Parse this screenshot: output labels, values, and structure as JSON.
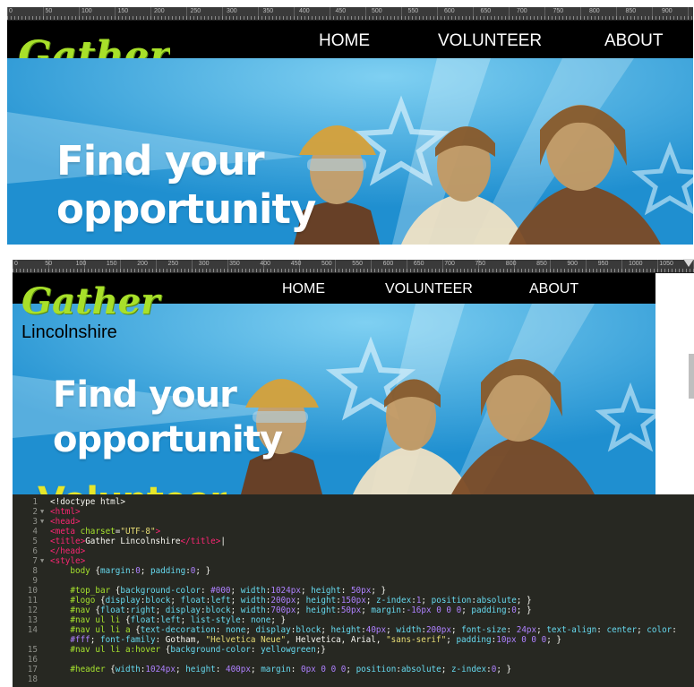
{
  "rulers": {
    "top_labels": [
      "0",
      "50",
      "100",
      "150",
      "200",
      "250",
      "300",
      "350",
      "400",
      "450",
      "500",
      "550",
      "600",
      "650",
      "700",
      "750",
      "800",
      "850",
      "900"
    ],
    "bottom_labels": [
      "0",
      "50",
      "100",
      "150",
      "200",
      "250",
      "300",
      "350",
      "400",
      "450",
      "500",
      "550",
      "600",
      "650",
      "700",
      "750",
      "800",
      "850",
      "900",
      "950",
      "1000",
      "1050"
    ]
  },
  "site": {
    "logo_title": "Gather",
    "logo_subtitle": "Lincolnshire",
    "nav": [
      "HOME",
      "VOLUNTEER",
      "ABOUT"
    ],
    "banner_line1": "Find your",
    "banner_line2": "opportunity",
    "banner_line3": "Volunteer"
  },
  "colors": {
    "top_bar": "#000000",
    "banner_blue": "#2aa0dc",
    "logo_green": "#a8e02a",
    "editor_bg": "#272822"
  },
  "editor": {
    "lines": [
      {
        "n": "1",
        "fold": "",
        "parts": [
          [
            "t-plain",
            "<!doctype html>"
          ]
        ]
      },
      {
        "n": "2",
        "fold": "▼",
        "parts": [
          [
            "t-tag",
            "<html>"
          ]
        ]
      },
      {
        "n": "3",
        "fold": "▼",
        "parts": [
          [
            "t-tag",
            "<head>"
          ]
        ]
      },
      {
        "n": "4",
        "fold": "",
        "parts": [
          [
            "t-tag",
            "<meta "
          ],
          [
            "t-attr",
            "charset"
          ],
          [
            "t-plain",
            "="
          ],
          [
            "t-str",
            "\"UTF-8\""
          ],
          [
            "t-tag",
            ">"
          ]
        ]
      },
      {
        "n": "5",
        "fold": "",
        "parts": [
          [
            "t-tag",
            "<title>"
          ],
          [
            "t-plain",
            "Gather Lincolnshire"
          ],
          [
            "t-tag",
            "</title>"
          ],
          [
            "t-plain",
            "|"
          ]
        ]
      },
      {
        "n": "6",
        "fold": "",
        "parts": [
          [
            "t-tag",
            "</head>"
          ]
        ]
      },
      {
        "n": "7",
        "fold": "▼",
        "parts": [
          [
            "t-tag",
            "<style>"
          ]
        ]
      },
      {
        "n": "8",
        "fold": "",
        "parts": [
          [
            "t-plain",
            "    "
          ],
          [
            "t-sel",
            "body"
          ],
          [
            "t-plain",
            " {"
          ],
          [
            "t-prop",
            "margin"
          ],
          [
            "t-plain",
            ":"
          ],
          [
            "t-num",
            "0"
          ],
          [
            "t-plain",
            "; "
          ],
          [
            "t-prop",
            "padding"
          ],
          [
            "t-plain",
            ":"
          ],
          [
            "t-num",
            "0"
          ],
          [
            "t-plain",
            "; }"
          ]
        ]
      },
      {
        "n": "9",
        "fold": "",
        "parts": [
          [
            "t-plain",
            ""
          ]
        ]
      },
      {
        "n": "10",
        "fold": "",
        "parts": [
          [
            "t-plain",
            "    "
          ],
          [
            "t-sel",
            "#top_bar"
          ],
          [
            "t-plain",
            " {"
          ],
          [
            "t-prop",
            "background-color"
          ],
          [
            "t-plain",
            ": "
          ],
          [
            "t-num",
            "#000"
          ],
          [
            "t-plain",
            "; "
          ],
          [
            "t-prop",
            "width"
          ],
          [
            "t-plain",
            ":"
          ],
          [
            "t-num",
            "1024px"
          ],
          [
            "t-plain",
            "; "
          ],
          [
            "t-prop",
            "height"
          ],
          [
            "t-plain",
            ": "
          ],
          [
            "t-num",
            "50px"
          ],
          [
            "t-plain",
            "; }"
          ]
        ]
      },
      {
        "n": "11",
        "fold": "",
        "parts": [
          [
            "t-plain",
            "    "
          ],
          [
            "t-sel",
            "#logo"
          ],
          [
            "t-plain",
            " {"
          ],
          [
            "t-prop",
            "display"
          ],
          [
            "t-plain",
            ":"
          ],
          [
            "t-prop",
            "block"
          ],
          [
            "t-plain",
            "; "
          ],
          [
            "t-prop",
            "float"
          ],
          [
            "t-plain",
            ":"
          ],
          [
            "t-prop",
            "left"
          ],
          [
            "t-plain",
            "; "
          ],
          [
            "t-prop",
            "width"
          ],
          [
            "t-plain",
            ":"
          ],
          [
            "t-num",
            "200px"
          ],
          [
            "t-plain",
            "; "
          ],
          [
            "t-prop",
            "height"
          ],
          [
            "t-plain",
            ":"
          ],
          [
            "t-num",
            "150px"
          ],
          [
            "t-plain",
            "; "
          ],
          [
            "t-prop",
            "z-index"
          ],
          [
            "t-plain",
            ":"
          ],
          [
            "t-num",
            "1"
          ],
          [
            "t-plain",
            "; "
          ],
          [
            "t-prop",
            "position"
          ],
          [
            "t-plain",
            ":"
          ],
          [
            "t-prop",
            "absolute"
          ],
          [
            "t-plain",
            "; }"
          ]
        ]
      },
      {
        "n": "12",
        "fold": "",
        "parts": [
          [
            "t-plain",
            "    "
          ],
          [
            "t-sel",
            "#nav"
          ],
          [
            "t-plain",
            " {"
          ],
          [
            "t-prop",
            "float"
          ],
          [
            "t-plain",
            ":"
          ],
          [
            "t-prop",
            "right"
          ],
          [
            "t-plain",
            "; "
          ],
          [
            "t-prop",
            "display"
          ],
          [
            "t-plain",
            ":"
          ],
          [
            "t-prop",
            "block"
          ],
          [
            "t-plain",
            "; "
          ],
          [
            "t-prop",
            "width"
          ],
          [
            "t-plain",
            ":"
          ],
          [
            "t-num",
            "700px"
          ],
          [
            "t-plain",
            "; "
          ],
          [
            "t-prop",
            "height"
          ],
          [
            "t-plain",
            ":"
          ],
          [
            "t-num",
            "50px"
          ],
          [
            "t-plain",
            "; "
          ],
          [
            "t-prop",
            "margin"
          ],
          [
            "t-plain",
            ":"
          ],
          [
            "t-num",
            "-16px 0 0 0"
          ],
          [
            "t-plain",
            "; "
          ],
          [
            "t-prop",
            "padding"
          ],
          [
            "t-plain",
            ":"
          ],
          [
            "t-num",
            "0"
          ],
          [
            "t-plain",
            "; }"
          ]
        ]
      },
      {
        "n": "13",
        "fold": "",
        "parts": [
          [
            "t-plain",
            "    "
          ],
          [
            "t-sel",
            "#nav ul li"
          ],
          [
            "t-plain",
            " {"
          ],
          [
            "t-prop",
            "float"
          ],
          [
            "t-plain",
            ":"
          ],
          [
            "t-prop",
            "left"
          ],
          [
            "t-plain",
            "; "
          ],
          [
            "t-prop",
            "list-style"
          ],
          [
            "t-plain",
            ": "
          ],
          [
            "t-prop",
            "none"
          ],
          [
            "t-plain",
            "; }"
          ]
        ]
      },
      {
        "n": "14",
        "fold": "",
        "parts": [
          [
            "t-plain",
            "    "
          ],
          [
            "t-sel",
            "#nav ul li a"
          ],
          [
            "t-plain",
            " {"
          ],
          [
            "t-prop",
            "text-decoration"
          ],
          [
            "t-plain",
            ": "
          ],
          [
            "t-prop",
            "none"
          ],
          [
            "t-plain",
            "; "
          ],
          [
            "t-prop",
            "display"
          ],
          [
            "t-plain",
            ":"
          ],
          [
            "t-prop",
            "block"
          ],
          [
            "t-plain",
            "; "
          ],
          [
            "t-prop",
            "height"
          ],
          [
            "t-plain",
            ":"
          ],
          [
            "t-num",
            "40px"
          ],
          [
            "t-plain",
            "; "
          ],
          [
            "t-prop",
            "width"
          ],
          [
            "t-plain",
            ":"
          ],
          [
            "t-num",
            "200px"
          ],
          [
            "t-plain",
            "; "
          ],
          [
            "t-prop",
            "font-size"
          ],
          [
            "t-plain",
            ": "
          ],
          [
            "t-num",
            "24px"
          ],
          [
            "t-plain",
            "; "
          ],
          [
            "t-prop",
            "text-align"
          ],
          [
            "t-plain",
            ": "
          ],
          [
            "t-prop",
            "center"
          ],
          [
            "t-plain",
            "; "
          ],
          [
            "t-prop",
            "color"
          ],
          [
            "t-plain",
            ":"
          ]
        ]
      },
      {
        "n": "",
        "fold": "",
        "parts": [
          [
            "t-plain",
            "    "
          ],
          [
            "t-num",
            "#fff"
          ],
          [
            "t-plain",
            "; "
          ],
          [
            "t-prop",
            "font-family"
          ],
          [
            "t-plain",
            ": Gotham, "
          ],
          [
            "t-str",
            "\"Helvetica Neue\""
          ],
          [
            "t-plain",
            ", Helvetica, Arial, "
          ],
          [
            "t-str",
            "\"sans-serif\""
          ],
          [
            "t-plain",
            "; "
          ],
          [
            "t-prop",
            "padding"
          ],
          [
            "t-plain",
            ":"
          ],
          [
            "t-num",
            "10px 0 0 0"
          ],
          [
            "t-plain",
            "; }"
          ]
        ]
      },
      {
        "n": "15",
        "fold": "",
        "parts": [
          [
            "t-plain",
            "    "
          ],
          [
            "t-sel",
            "#nav ul li a:hover"
          ],
          [
            "t-plain",
            " {"
          ],
          [
            "t-prop",
            "background-color"
          ],
          [
            "t-plain",
            ": "
          ],
          [
            "t-prop",
            "yellowgreen"
          ],
          [
            "t-plain",
            ";}"
          ]
        ]
      },
      {
        "n": "16",
        "fold": "",
        "parts": [
          [
            "t-plain",
            ""
          ]
        ]
      },
      {
        "n": "17",
        "fold": "",
        "parts": [
          [
            "t-plain",
            "    "
          ],
          [
            "t-sel",
            "#header"
          ],
          [
            "t-plain",
            " {"
          ],
          [
            "t-prop",
            "width"
          ],
          [
            "t-plain",
            ":"
          ],
          [
            "t-num",
            "1024px"
          ],
          [
            "t-plain",
            "; "
          ],
          [
            "t-prop",
            "height"
          ],
          [
            "t-plain",
            ": "
          ],
          [
            "t-num",
            "400px"
          ],
          [
            "t-plain",
            "; "
          ],
          [
            "t-prop",
            "margin"
          ],
          [
            "t-plain",
            ": "
          ],
          [
            "t-num",
            "0px 0 0 0"
          ],
          [
            "t-plain",
            "; "
          ],
          [
            "t-prop",
            "position"
          ],
          [
            "t-plain",
            ":"
          ],
          [
            "t-prop",
            "absolute"
          ],
          [
            "t-plain",
            "; "
          ],
          [
            "t-prop",
            "z-index"
          ],
          [
            "t-plain",
            ":"
          ],
          [
            "t-num",
            "0"
          ],
          [
            "t-plain",
            "; }"
          ]
        ]
      },
      {
        "n": "18",
        "fold": "",
        "parts": [
          [
            "t-plain",
            ""
          ]
        ]
      }
    ]
  }
}
